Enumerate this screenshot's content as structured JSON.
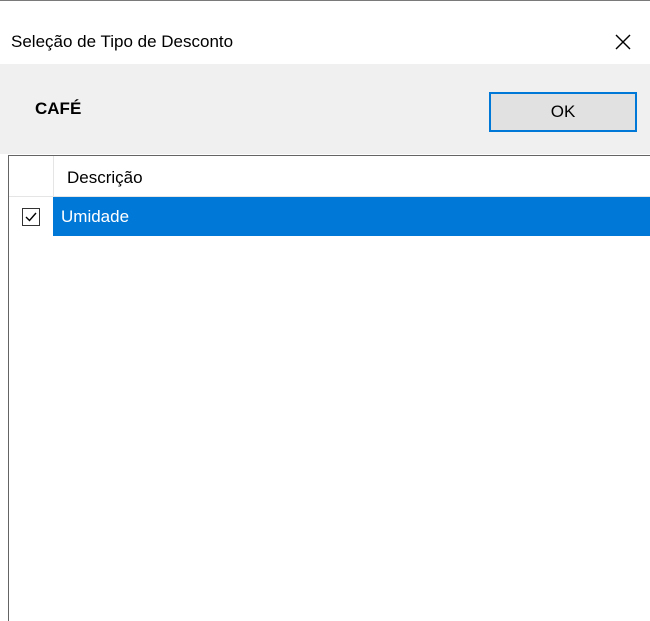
{
  "window": {
    "title": "Seleção de Tipo de Desconto"
  },
  "toolbar": {
    "product_name": "CAFÉ",
    "ok_label": "OK"
  },
  "grid": {
    "columns": [
      "",
      "Descrição"
    ],
    "rows": [
      {
        "checked": true,
        "description": "Umidade",
        "selected": true
      }
    ]
  },
  "colors": {
    "selection": "#0078d7",
    "toolbar_bg": "#f0f0f0",
    "button_bg": "#e1e1e1"
  },
  "icons": {
    "close": "close-icon",
    "check": "checkmark-icon"
  }
}
